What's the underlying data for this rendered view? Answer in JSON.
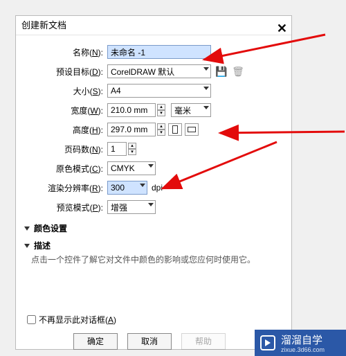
{
  "dialog": {
    "title": "创建新文档",
    "fields": {
      "name_label_pre": "名称(",
      "name_label_u": "N",
      "name_label_post": "):",
      "name_value": "未命名 -1",
      "preset_label_pre": "预设目标(",
      "preset_label_u": "D",
      "preset_label_post": "):",
      "preset_value": "CorelDRAW 默认",
      "size_label_pre": "大小(",
      "size_label_u": "S",
      "size_label_post": "):",
      "size_value": "A4",
      "width_label_pre": "宽度(",
      "width_label_u": "W",
      "width_label_post": "):",
      "width_value": "210.0 mm",
      "width_unit": "毫米",
      "height_label_pre": "高度(",
      "height_label_u": "H",
      "height_label_post": "):",
      "height_value": "297.0 mm",
      "pages_label_pre": "页码数(",
      "pages_label_u": "N",
      "pages_label_post": "):",
      "pages_value": "1",
      "colormode_label_pre": "原色模式(",
      "colormode_label_u": "C",
      "colormode_label_post": "):",
      "colormode_value": "CMYK",
      "res_label_pre": "渲染分辨率(",
      "res_label_u": "R",
      "res_label_post": "):",
      "res_value": "300",
      "res_unit": "dpi",
      "preview_label_pre": "预览模式(",
      "preview_label_u": "P",
      "preview_label_post": "):",
      "preview_value": "增强"
    },
    "sections": {
      "color": "颜色设置",
      "desc_title": "描述",
      "desc_text": "点击一个控件了解它对文件中颜色的影响或您应何时使用它。"
    },
    "noshow_pre": "不再显示此对话框(",
    "noshow_u": "A",
    "noshow_post": ")",
    "ok": "确定",
    "cancel": "取消",
    "help": "帮助"
  },
  "badge": {
    "name": "溜溜自学",
    "sub": "zixue.3d66.com"
  }
}
